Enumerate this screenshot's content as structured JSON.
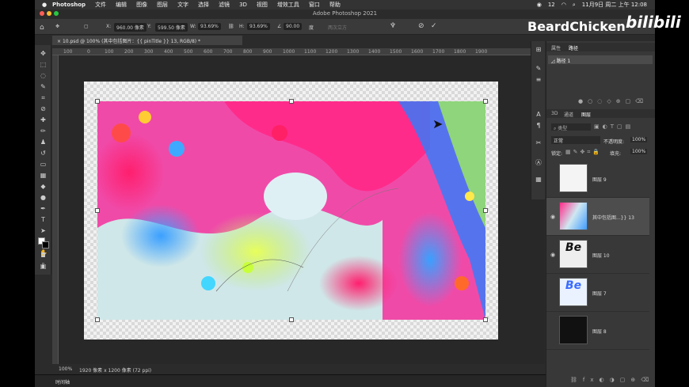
{
  "menubar": {
    "app_name": "Photoshop",
    "items": [
      "文件",
      "编辑",
      "图像",
      "图层",
      "文字",
      "选择",
      "滤镜",
      "3D",
      "视图",
      "增效工具",
      "窗口",
      "帮助"
    ],
    "status_text": "12",
    "datetime": "11月9日 周二 上午 12:08"
  },
  "window": {
    "title": "Adobe Photoshop 2021"
  },
  "options_bar": {
    "x_label": "X:",
    "x_value": "960.00 像素",
    "y_label": "Y:",
    "y_value": "599.50 像素",
    "w_label": "W:",
    "w_value": "93.69%",
    "h_label": "H:",
    "h_value": "93.69%",
    "angle_value": "90.00",
    "angle_unit": "度",
    "interp": "两次立方"
  },
  "document": {
    "tab_label": "10.psd @ 100% (其中包括图片：{{ pinTitle }} 13, RGB/8) *"
  },
  "ruler": {
    "ticks": [
      "100",
      "0",
      "100",
      "200",
      "300",
      "400",
      "500",
      "600",
      "700",
      "800",
      "900",
      "1000",
      "1100",
      "1200",
      "1300",
      "1400",
      "1500",
      "1600",
      "1700",
      "1800",
      "1900"
    ]
  },
  "statusbar": {
    "zoom": "100%",
    "doc_info": "1920 像素 x 1200 像素 (72 ppi)"
  },
  "timeline": {
    "label": "时间轴"
  },
  "panels": {
    "top_tabs": [
      "属性",
      "路径"
    ],
    "path_item": "路径 1",
    "layer_tabs": [
      "3D",
      "通道",
      "图层"
    ],
    "search_label": "类型",
    "blend_mode": "正常",
    "opacity_label": "不透明度:",
    "opacity_value": "100%",
    "lock_label": "锁定:",
    "fill_label": "填充:",
    "fill_value": "100%",
    "layers": [
      {
        "name": "图层 9",
        "visible": false
      },
      {
        "name": "其中包括图...}} 13",
        "visible": true
      },
      {
        "name": "图层 10",
        "visible": true
      },
      {
        "name": "图层 7",
        "visible": false
      },
      {
        "name": "图层 8",
        "visible": false
      }
    ]
  },
  "watermark": {
    "text": "BeardChicken",
    "logo": "bilibili"
  },
  "colors": {
    "accent": "#ff2b8a",
    "panel_bg": "#383838",
    "app_bg": "#2b2b2b"
  }
}
